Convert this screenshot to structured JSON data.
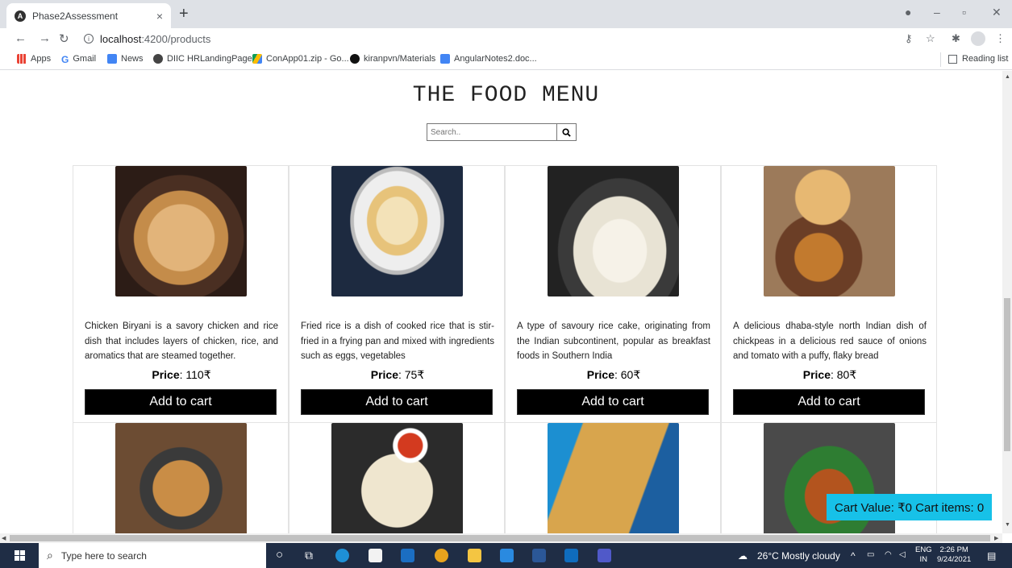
{
  "browser": {
    "tab_title": "Phase2Assessment",
    "tab_close": "×",
    "new_tab": "+",
    "url_host": "localhost",
    "url_path": ":4200/products",
    "bookmarks": [
      "Apps",
      "Gmail",
      "News",
      "DIIC HRLandingPage",
      "ConApp01.zip - Go...",
      "kiranpvn/Materials",
      "AngularNotes2.doc..."
    ],
    "reading_list": "Reading list"
  },
  "page": {
    "title": "THE FOOD MENU",
    "search_placeholder": "Search.."
  },
  "products": [
    {
      "desc": "Chicken Biryani is a savory chicken and rice dish that includes layers of chicken, rice, and aromatics that are steamed together.",
      "price_label": "Price",
      "price_value": ": 110₹",
      "button": "Add to cart"
    },
    {
      "desc": "Fried rice is a dish of cooked rice that is stir-fried in a frying pan and mixed with ingredients such as eggs, vegetables",
      "price_label": "Price",
      "price_value": ": 75₹",
      "button": "Add to cart"
    },
    {
      "desc": "A type of savoury rice cake, originating from the Indian subcontinent, popular as breakfast foods in Southern India",
      "price_label": "Price",
      "price_value": ": 60₹",
      "button": "Add to cart"
    },
    {
      "desc": "A delicious dhaba-style north Indian dish of chickpeas in a delicious red sauce of onions and tomato with a puffy, flaky bread",
      "price_label": "Price",
      "price_value": ": 80₹",
      "button": "Add to cart"
    }
  ],
  "cart": {
    "text": "Cart Value: ₹0 Cart items: 0"
  },
  "taskbar": {
    "search_placeholder": "Type here to search",
    "weather": "26°C  Mostly cloudy",
    "lang_top": "ENG",
    "lang_bottom": "IN",
    "time": "2:26 PM",
    "date": "9/24/2021"
  }
}
